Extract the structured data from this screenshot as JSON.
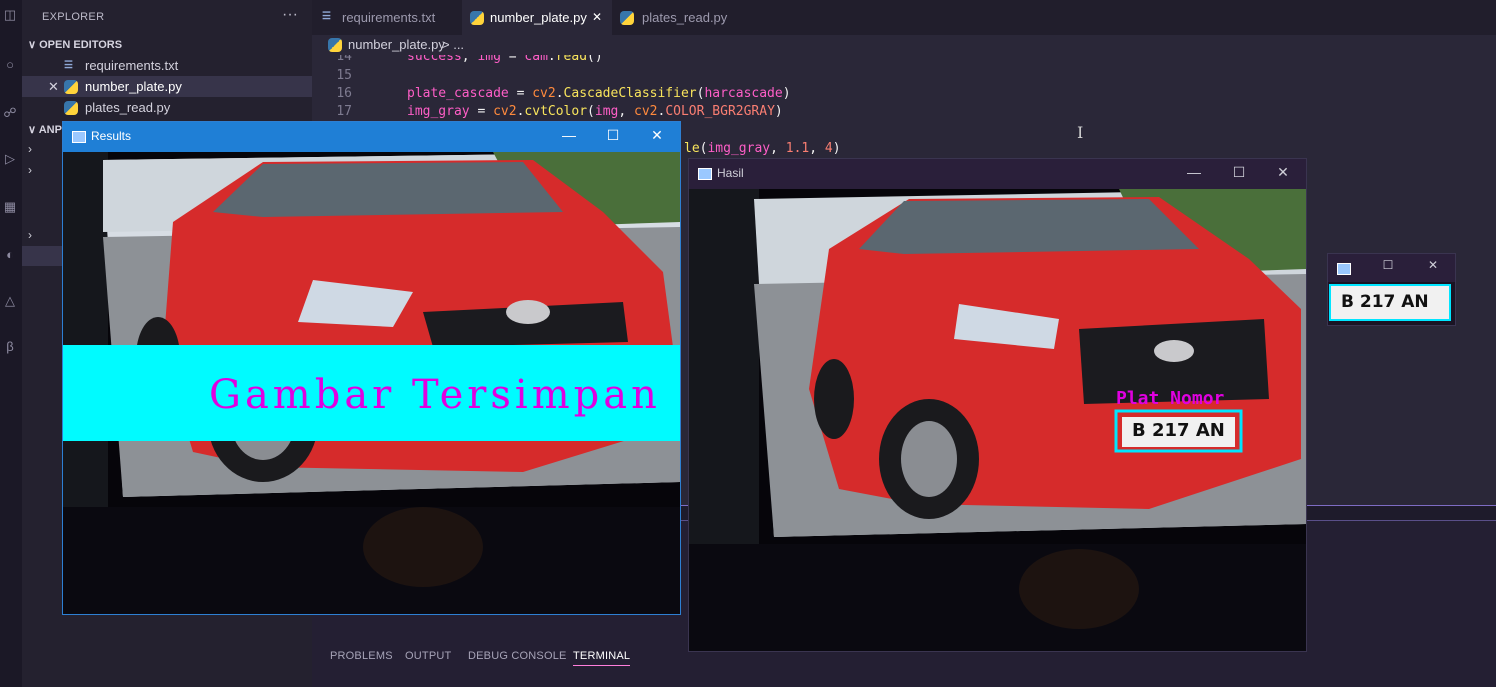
{
  "explorer": {
    "title": "EXPLORER",
    "more": "···",
    "open_editors_label": "OPEN EDITORS",
    "open_editors": [
      {
        "name": "requirements.txt",
        "icon": "txt-file-icon"
      },
      {
        "name": "number_plate.py",
        "icon": "python-file-icon",
        "active": true,
        "close": "✕"
      },
      {
        "name": "plates_read.py",
        "icon": "python-file-icon"
      }
    ],
    "folder_label": "ANP"
  },
  "tabs": [
    {
      "label": "requirements.txt"
    },
    {
      "label": "number_plate.py",
      "close": "✕"
    },
    {
      "label": "plates_read.py"
    }
  ],
  "breadcrumb": {
    "file": "number_plate.py",
    "trail": "> ..."
  },
  "code": {
    "lines": [
      {
        "n": "14",
        "text": "success, img = cam.read()"
      },
      {
        "n": "15",
        "text": ""
      },
      {
        "n": "16",
        "text": "plate_cascade = cv2.CascadeClassifier(harcascade)"
      },
      {
        "n": "17",
        "text": "img_gray = cv2.cvtColor(img, cv2.COLOR_BGR2GRAY)"
      }
    ],
    "partial_line": "le(img_gray, 1.1, 4)"
  },
  "panel_tabs": [
    "PROBLEMS",
    "OUTPUT",
    "DEBUG CONSOLE",
    "TERMINAL"
  ],
  "panel_active": "TERMINAL",
  "results_window": {
    "title": "Results",
    "banner_text": "Gambar Tersimpan",
    "minimize": "—",
    "maximize": "☐",
    "close": "✕"
  },
  "hasil_window": {
    "title": "Hasil",
    "detection_label": "Plat Nomor",
    "plate_text": "B  217  AN",
    "minimize": "—",
    "maximize": "☐",
    "close": "✕"
  },
  "crop_window": {
    "plate_text": "B  217  AN",
    "maximize": "☐",
    "close": "✕"
  },
  "colors": {
    "banner": "#00fbff",
    "banner_text": "#e000e0",
    "detection_box": "#00e5ff",
    "results_titlebar": "#1f7fd6"
  }
}
